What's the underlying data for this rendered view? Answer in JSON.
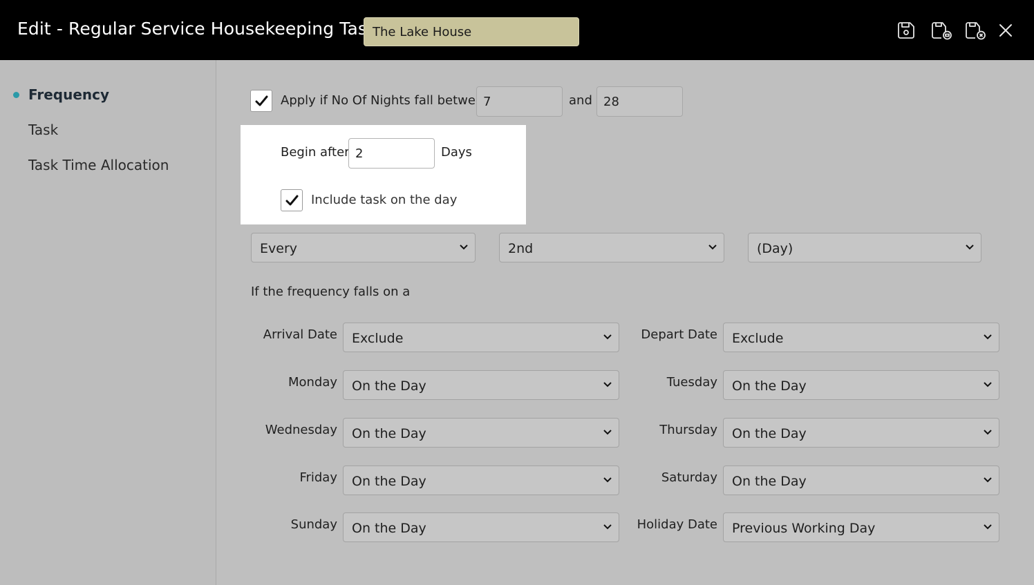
{
  "header": {
    "title": "Edit - Regular Service Housekeeping Task",
    "property": "The Lake House",
    "buttons": [
      "save-icon",
      "save-and-copy-icon",
      "save-and-close-icon",
      "close-icon"
    ]
  },
  "sidebar": {
    "items": [
      {
        "label": "Frequency",
        "active": true
      },
      {
        "label": "Task",
        "active": false
      },
      {
        "label": "Task Time Allocation",
        "active": false
      }
    ]
  },
  "frequency": {
    "nights_label": "Apply if No Of Nights fall between",
    "nights_checked": true,
    "nights_from": "7",
    "and_label": "and",
    "nights_to": "28",
    "begin_after_label": "Begin after",
    "begin_after_value": "2",
    "days_label": "Days",
    "include_label": "Include task on the day",
    "include_checked": true,
    "every": "Every",
    "interval": "2nd",
    "unit": "(Day)",
    "falls_on_label": "If the frequency falls on a"
  },
  "rules": [
    {
      "label": "Arrival Date",
      "value": "Exclude"
    },
    {
      "label": "Depart Date",
      "value": "Exclude"
    },
    {
      "label": "Monday",
      "value": "On the Day"
    },
    {
      "label": "Tuesday",
      "value": "On the Day"
    },
    {
      "label": "Wednesday",
      "value": "On the Day"
    },
    {
      "label": "Thursday",
      "value": "On the Day"
    },
    {
      "label": "Friday",
      "value": "On the Day"
    },
    {
      "label": "Saturday",
      "value": "On the Day"
    },
    {
      "label": "Sunday",
      "value": "On the Day"
    },
    {
      "label": "Holiday Date",
      "value": "Previous Working Day"
    }
  ],
  "colors": {
    "header_bg": "#000000",
    "property_bg": "#c8c39a",
    "accent": "#2a9aa8",
    "panel_bg": "#bfbfbf"
  }
}
